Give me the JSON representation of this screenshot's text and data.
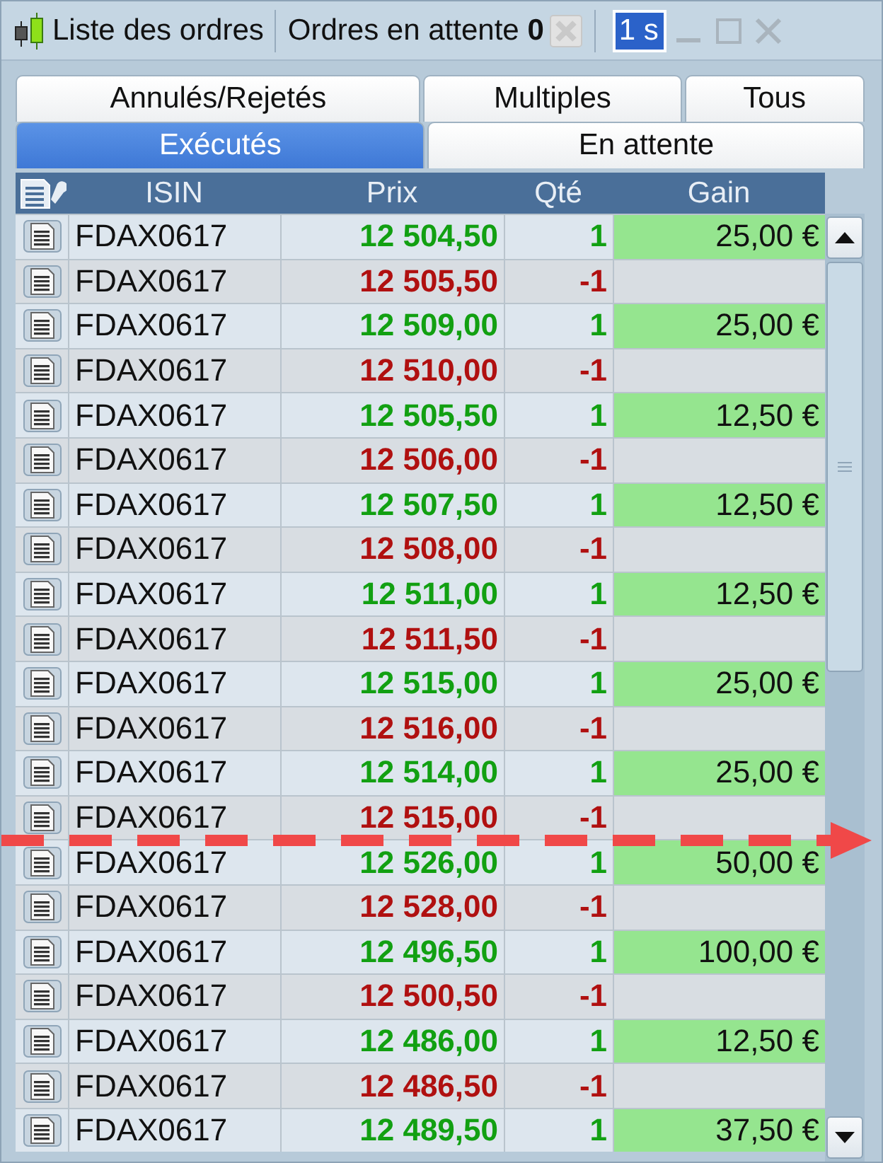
{
  "window": {
    "title": "Liste des ordres",
    "pending_label": "Ordres en attente **0**",
    "interval_field": {
      "value": "1 s"
    }
  },
  "tabs": [
    [
      {
        "label": "Annulés/Rejetés",
        "selected": false
      },
      {
        "label": "Multiples",
        "selected": false
      },
      {
        "label": "Tous",
        "selected": false
      }
    ],
    [
      {
        "label": "Exécutés",
        "selected": true
      },
      {
        "label": "En attente",
        "selected": false
      }
    ]
  ],
  "table": {
    "columns": [
      "ISIN",
      "Prix",
      "Qté",
      "Gain"
    ],
    "rows": [
      {
        "kind": "buy",
        "isin": "FDAX0617",
        "price": "12 504,50",
        "qty": "1",
        "gain": "25,00 €"
      },
      {
        "kind": "sell",
        "isin": "FDAX0617",
        "price": "12 505,50",
        "qty": "-1"
      },
      {
        "kind": "buy",
        "isin": "FDAX0617",
        "price": "12 509,00",
        "qty": "1",
        "gain": "25,00 €"
      },
      {
        "kind": "sell",
        "isin": "FDAX0617",
        "price": "12 510,00",
        "qty": "-1"
      },
      {
        "kind": "buy",
        "isin": "FDAX0617",
        "price": "12 505,50",
        "qty": "1",
        "gain": "12,50 €"
      },
      {
        "kind": "sell",
        "isin": "FDAX0617",
        "price": "12 506,00",
        "qty": "-1"
      },
      {
        "kind": "buy",
        "isin": "FDAX0617",
        "price": "12 507,50",
        "qty": "1",
        "gain": "12,50 €"
      },
      {
        "kind": "sell",
        "isin": "FDAX0617",
        "price": "12 508,00",
        "qty": "-1"
      },
      {
        "kind": "buy",
        "isin": "FDAX0617",
        "price": "12 511,00",
        "qty": "1",
        "gain": "12,50 €"
      },
      {
        "kind": "sell",
        "isin": "FDAX0617",
        "price": "12 511,50",
        "qty": "-1"
      },
      {
        "kind": "buy",
        "isin": "FDAX0617",
        "price": "12 515,00",
        "qty": "1",
        "gain": "25,00 €"
      },
      {
        "kind": "sell",
        "isin": "FDAX0617",
        "price": "12 516,00",
        "qty": "-1"
      },
      {
        "kind": "buy",
        "isin": "FDAX0617",
        "price": "12 514,00",
        "qty": "1",
        "gain": "25,00 €"
      },
      {
        "kind": "sell",
        "isin": "FDAX0617",
        "price": "12 515,00",
        "qty": "-1"
      },
      {
        "kind": "buy",
        "isin": "FDAX0617",
        "price": "12 526,00",
        "qty": "1",
        "gain": "50,00 €"
      },
      {
        "kind": "sell",
        "isin": "FDAX0617",
        "price": "12 528,00",
        "qty": "-1"
      },
      {
        "kind": "buy",
        "isin": "FDAX0617",
        "price": "12 496,50",
        "qty": "1",
        "gain": "100,00 €"
      },
      {
        "kind": "sell",
        "isin": "FDAX0617",
        "price": "12 500,50",
        "qty": "-1"
      },
      {
        "kind": "buy",
        "isin": "FDAX0617",
        "price": "12 486,00",
        "qty": "1",
        "gain": "12,50 €"
      },
      {
        "kind": "sell",
        "isin": "FDAX0617",
        "price": "12 486,50",
        "qty": "-1"
      },
      {
        "kind": "buy",
        "isin": "FDAX0617",
        "price": "12 489,50",
        "qty": "1",
        "gain": "37,50 €"
      }
    ]
  }
}
